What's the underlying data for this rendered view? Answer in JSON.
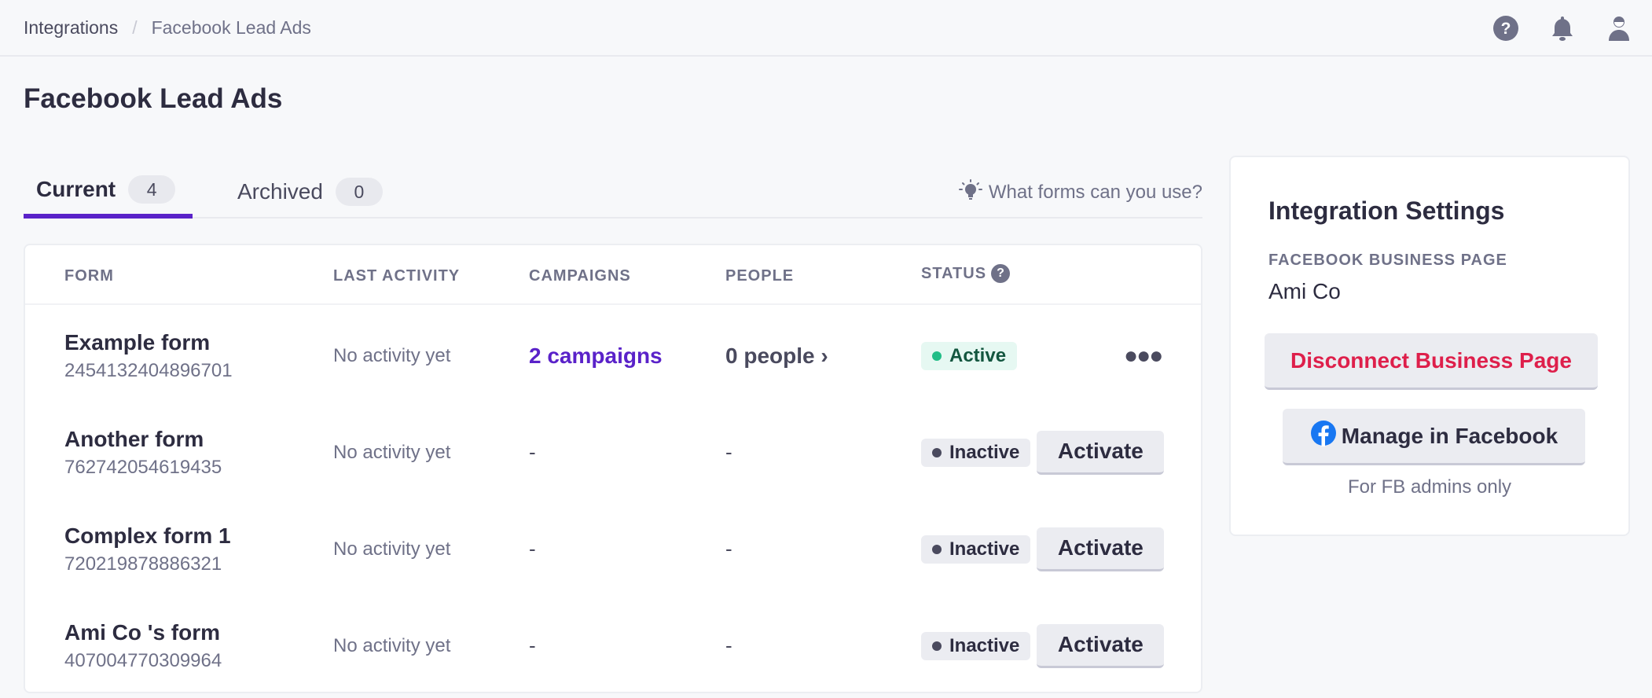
{
  "breadcrumb": {
    "root": "Integrations",
    "separator": "/",
    "current": "Facebook Lead Ads"
  },
  "header_icons": [
    "help-icon",
    "bell-icon",
    "user-icon"
  ],
  "page_title": "Facebook Lead Ads",
  "tabs": [
    {
      "label": "Current",
      "count": "4",
      "active": true
    },
    {
      "label": "Archived",
      "count": "0",
      "active": false
    }
  ],
  "help_link": {
    "icon": "lightbulb-icon",
    "label": "What forms can you use?"
  },
  "table": {
    "columns": [
      "FORM",
      "LAST ACTIVITY",
      "CAMPAIGNS",
      "PEOPLE",
      "STATUS"
    ],
    "status_help_icon": "?",
    "rows": [
      {
        "name": "Example form",
        "id": "2454132404896701",
        "last_activity": "No activity yet",
        "campaigns": "2 campaigns",
        "people": "0 people ›",
        "status": "Active",
        "action": "more-icon"
      },
      {
        "name": "Another form",
        "id": "762742054619435",
        "last_activity": "No activity yet",
        "campaigns": "-",
        "people": "-",
        "status": "Inactive",
        "action": "Activate"
      },
      {
        "name": "Complex form 1",
        "id": "720219878886321",
        "last_activity": "No activity yet",
        "campaigns": "-",
        "people": "-",
        "status": "Inactive",
        "action": "Activate"
      },
      {
        "name": "Ami Co 's form",
        "id": "407004770309964",
        "last_activity": "No activity yet",
        "campaigns": "-",
        "people": "-",
        "status": "Inactive",
        "action": "Activate"
      }
    ]
  },
  "settings": {
    "title": "Integration Settings",
    "page_label": "FACEBOOK BUSINESS PAGE",
    "page_value": "Ami Co",
    "disconnect_label": "Disconnect Business Page",
    "manage_label": "Manage in Facebook",
    "manage_note": "For FB admins only"
  },
  "colors": {
    "accent": "#5a22c9",
    "danger": "#de1f4b",
    "active_dot": "#22bd87",
    "facebook": "#1877f2"
  }
}
